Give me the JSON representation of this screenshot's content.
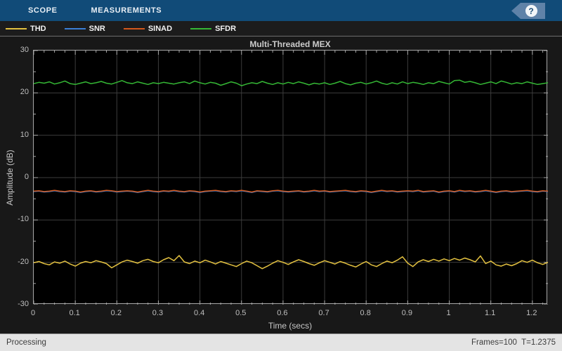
{
  "toolbar": {
    "tabs": [
      {
        "label": "SCOPE"
      },
      {
        "label": "MEASUREMENTS"
      }
    ],
    "help_label": "?"
  },
  "status_bar": {
    "left": "Processing",
    "right": "Frames=100  T=1.2375"
  },
  "colors": {
    "toolbar_bg": "#114b78",
    "help_tag_bg": "#5f82a8",
    "plot_bg": "#000000",
    "figure_bg": "#181818",
    "grid": "#3c3c3c",
    "axis_frame": "#a8a8a8",
    "status_bg": "#e4e4e4"
  },
  "chart_data": {
    "type": "line",
    "title": "Multi-Threaded MEX",
    "xlabel": "Time (secs)",
    "ylabel": "Amplitude (dB)",
    "xlim": [
      0,
      1.2375
    ],
    "ylim": [
      -30,
      30
    ],
    "grid": true,
    "legend_position": "top-bar",
    "sample_interval": 0.0125,
    "x_ticks": {
      "values": [
        0,
        0.1,
        0.2,
        0.3,
        0.4,
        0.5,
        0.6,
        0.7,
        0.8,
        0.9,
        1,
        1.1,
        1.2
      ],
      "labels": [
        "0",
        "0.1",
        "0.2",
        "0.3",
        "0.4",
        "0.5",
        "0.6",
        "0.7",
        "0.8",
        "0.9",
        "1",
        "1.1",
        "1.2"
      ]
    },
    "y_ticks": {
      "values": [
        30,
        20,
        10,
        0,
        -10,
        -20,
        -30
      ],
      "labels": [
        "30",
        "20",
        "10",
        "0",
        "-10",
        "-20",
        "-30"
      ]
    },
    "x_minor_step": 0.025,
    "y_minor_step": 5,
    "series": [
      {
        "name": "THD",
        "color": "#e3c140",
        "values": [
          -20.1,
          -19.8,
          -20.3,
          -20.6,
          -19.9,
          -20.2,
          -19.7,
          -20.4,
          -20.9,
          -20.2,
          -19.8,
          -20.1,
          -19.6,
          -19.9,
          -20.3,
          -21.3,
          -20.6,
          -19.9,
          -19.5,
          -19.8,
          -20.2,
          -19.6,
          -19.3,
          -19.8,
          -20.1,
          -19.4,
          -18.9,
          -19.6,
          -18.4,
          -19.9,
          -20.3,
          -19.7,
          -20.1,
          -19.5,
          -19.9,
          -20.4,
          -19.8,
          -20.2,
          -20.6,
          -21.0,
          -20.3,
          -19.7,
          -20.1,
          -20.8,
          -21.5,
          -20.9,
          -20.2,
          -19.6,
          -20.0,
          -20.5,
          -19.9,
          -19.4,
          -19.8,
          -20.3,
          -20.7,
          -20.1,
          -19.6,
          -20.0,
          -20.4,
          -19.8,
          -20.2,
          -20.7,
          -21.1,
          -20.4,
          -19.8,
          -20.6,
          -21.0,
          -20.3,
          -19.7,
          -20.1,
          -19.5,
          -18.7,
          -20.2,
          -21.0,
          -19.9,
          -19.4,
          -19.8,
          -19.3,
          -19.7,
          -19.2,
          -19.6,
          -19.1,
          -19.5,
          -19.0,
          -19.4,
          -19.9,
          -18.5,
          -20.3,
          -19.7,
          -20.6,
          -20.9,
          -20.4,
          -20.8,
          -20.3,
          -19.6,
          -20.0,
          -19.5,
          -20.1,
          -20.5,
          -20.0
        ]
      },
      {
        "name": "SNR",
        "color": "#3b7fd6",
        "values": [
          -3.3,
          -3.2,
          -3.4,
          -3.3,
          -3.1,
          -3.3,
          -3.4,
          -3.2,
          -3.3,
          -3.5,
          -3.3,
          -3.2,
          -3.4,
          -3.3,
          -3.1,
          -3.2,
          -3.4,
          -3.3,
          -3.2,
          -3.3,
          -3.5,
          -3.3,
          -3.1,
          -3.3,
          -3.4,
          -3.2,
          -3.3,
          -3.1,
          -3.3,
          -3.4,
          -3.2,
          -3.3,
          -3.5,
          -3.3,
          -3.2,
          -3.1,
          -3.3,
          -3.4,
          -3.2,
          -3.3,
          -3.1,
          -3.3,
          -3.5,
          -3.2,
          -3.3,
          -3.4,
          -3.2,
          -3.1,
          -3.3,
          -3.4,
          -3.3,
          -3.2,
          -3.4,
          -3.3,
          -3.1,
          -3.3,
          -3.2,
          -3.4,
          -3.3,
          -3.2,
          -3.1,
          -3.3,
          -3.4,
          -3.2,
          -3.3,
          -3.5,
          -3.3,
          -3.1,
          -3.3,
          -3.2,
          -3.4,
          -3.3,
          -3.2,
          -3.3,
          -3.1,
          -3.4,
          -3.3,
          -3.2,
          -3.5,
          -3.3,
          -3.2,
          -3.4,
          -3.1,
          -3.3,
          -3.2,
          -3.4,
          -3.3,
          -3.1,
          -3.3,
          -3.5,
          -3.3,
          -3.2,
          -3.4,
          -3.3,
          -3.2,
          -3.1,
          -3.3,
          -3.4,
          -3.2,
          -3.3
        ]
      },
      {
        "name": "SINAD",
        "color": "#d4581c",
        "values": [
          -3.2,
          -3.1,
          -3.3,
          -3.2,
          -3.0,
          -3.2,
          -3.3,
          -3.1,
          -3.2,
          -3.4,
          -3.2,
          -3.1,
          -3.3,
          -3.2,
          -3.0,
          -3.1,
          -3.3,
          -3.2,
          -3.1,
          -3.2,
          -3.4,
          -3.2,
          -3.0,
          -3.2,
          -3.3,
          -3.1,
          -3.2,
          -3.0,
          -3.2,
          -3.3,
          -3.1,
          -3.2,
          -3.4,
          -3.2,
          -3.1,
          -3.0,
          -3.2,
          -3.3,
          -3.1,
          -3.2,
          -3.0,
          -3.2,
          -3.4,
          -3.1,
          -3.2,
          -3.3,
          -3.1,
          -3.0,
          -3.2,
          -3.3,
          -3.2,
          -3.1,
          -3.3,
          -3.2,
          -3.0,
          -3.2,
          -3.1,
          -3.3,
          -3.2,
          -3.1,
          -3.0,
          -3.2,
          -3.3,
          -3.1,
          -3.2,
          -3.4,
          -3.2,
          -3.0,
          -3.2,
          -3.1,
          -3.3,
          -3.2,
          -3.1,
          -3.2,
          -3.0,
          -3.3,
          -3.2,
          -3.1,
          -3.4,
          -3.2,
          -3.1,
          -3.3,
          -3.0,
          -3.2,
          -3.1,
          -3.3,
          -3.2,
          -3.0,
          -3.2,
          -3.4,
          -3.2,
          -3.1,
          -3.3,
          -3.2,
          -3.1,
          -3.0,
          -3.2,
          -3.3,
          -3.1,
          -3.2
        ]
      },
      {
        "name": "SFDR",
        "color": "#35b835",
        "values": [
          22.2,
          22.5,
          22.3,
          22.6,
          22.1,
          22.4,
          22.8,
          22.2,
          22.0,
          22.3,
          22.6,
          22.2,
          22.4,
          22.7,
          22.3,
          22.1,
          22.5,
          22.9,
          22.4,
          22.2,
          22.6,
          22.3,
          22.0,
          22.4,
          22.2,
          22.5,
          22.3,
          22.1,
          22.4,
          22.6,
          22.2,
          22.8,
          22.4,
          22.1,
          22.5,
          22.3,
          21.8,
          22.2,
          22.6,
          22.3,
          21.7,
          22.1,
          22.4,
          22.2,
          22.7,
          22.3,
          22.0,
          22.4,
          22.1,
          22.5,
          22.2,
          22.6,
          22.3,
          21.9,
          22.3,
          22.1,
          22.4,
          22.0,
          22.3,
          22.7,
          22.2,
          21.9,
          22.3,
          22.5,
          22.1,
          22.4,
          22.8,
          22.3,
          22.0,
          22.4,
          22.1,
          22.6,
          22.2,
          22.5,
          22.3,
          22.0,
          22.4,
          22.2,
          22.7,
          22.4,
          22.1,
          22.9,
          23.0,
          22.5,
          22.7,
          22.4,
          22.0,
          22.3,
          22.6,
          22.2,
          22.8,
          22.5,
          22.1,
          22.4,
          22.2,
          22.6,
          22.3,
          22.0,
          22.2,
          22.4
        ]
      }
    ]
  }
}
